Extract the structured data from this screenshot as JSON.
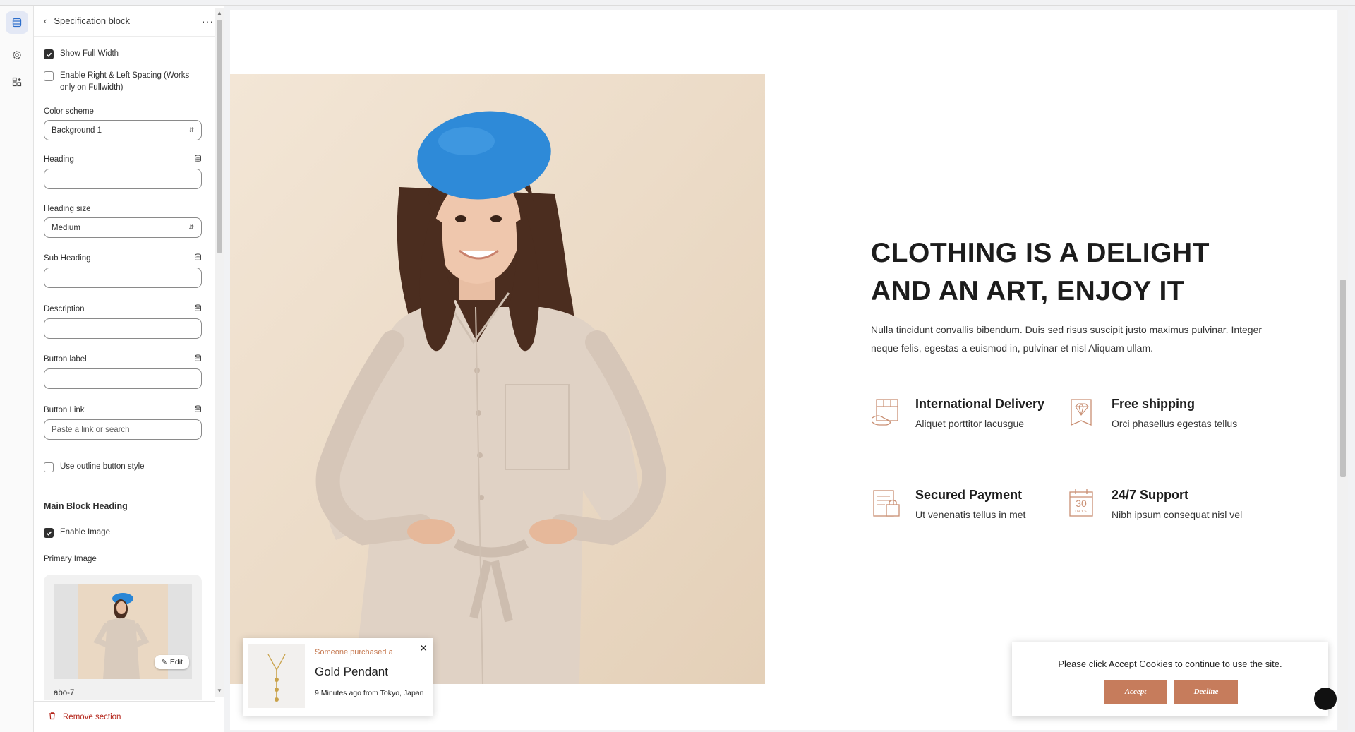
{
  "panel": {
    "title": "Specification block",
    "show_full_width": "Show Full Width",
    "enable_spacing": "Enable Right & Left Spacing (Works only on Fullwidth)",
    "color_scheme": {
      "label": "Color scheme",
      "value": "Background 1"
    },
    "heading": {
      "label": "Heading",
      "value": ""
    },
    "heading_size": {
      "label": "Heading size",
      "value": "Medium"
    },
    "sub_heading": {
      "label": "Sub Heading",
      "value": ""
    },
    "description": {
      "label": "Description",
      "value": ""
    },
    "button_label": {
      "label": "Button label",
      "value": ""
    },
    "button_link": {
      "label": "Button Link",
      "placeholder": "Paste a link or search"
    },
    "outline_button": "Use outline button style",
    "main_block_heading": "Main Block Heading",
    "enable_image": "Enable Image",
    "primary_image": {
      "label": "Primary Image",
      "edit": "Edit",
      "name": "abo-7"
    },
    "remove_section": "Remove section"
  },
  "preview": {
    "title_line1": "CLOTHING IS A DELIGHT",
    "title_line2": "AND AN ART, ENJOY IT",
    "description": "Nulla tincidunt convallis bibendum. Duis sed risus suscipit justo maximus pulvinar. Integer neque felis, egestas a euismod in, pulvinar et nisl Aliquam ullam.",
    "features": [
      {
        "title": "International Delivery",
        "text": "Aliquet porttitor lacusgue",
        "icon": "delivery-box-icon"
      },
      {
        "title": "Free shipping",
        "text": "Orci phasellus egestas tellus",
        "icon": "diamond-tag-icon"
      },
      {
        "title": "Secured Payment",
        "text": "Ut venenatis tellus in met",
        "icon": "secure-payment-icon"
      },
      {
        "title": "24/7 Support",
        "text": "Nibh ipsum consequat nisl vel",
        "icon": "calendar-30-days-icon"
      }
    ],
    "calendar_number": "30",
    "calendar_caption": "DAYS",
    "accent_color": "#c67c5c"
  },
  "toast": {
    "line1": "Someone purchased a",
    "product": "Gold Pendant",
    "line3": "9 Minutes ago from Tokyo, Japan"
  },
  "cookie": {
    "message": "Please click Accept Cookies to continue to use the site.",
    "accept": "Accept",
    "decline": "Decline"
  }
}
